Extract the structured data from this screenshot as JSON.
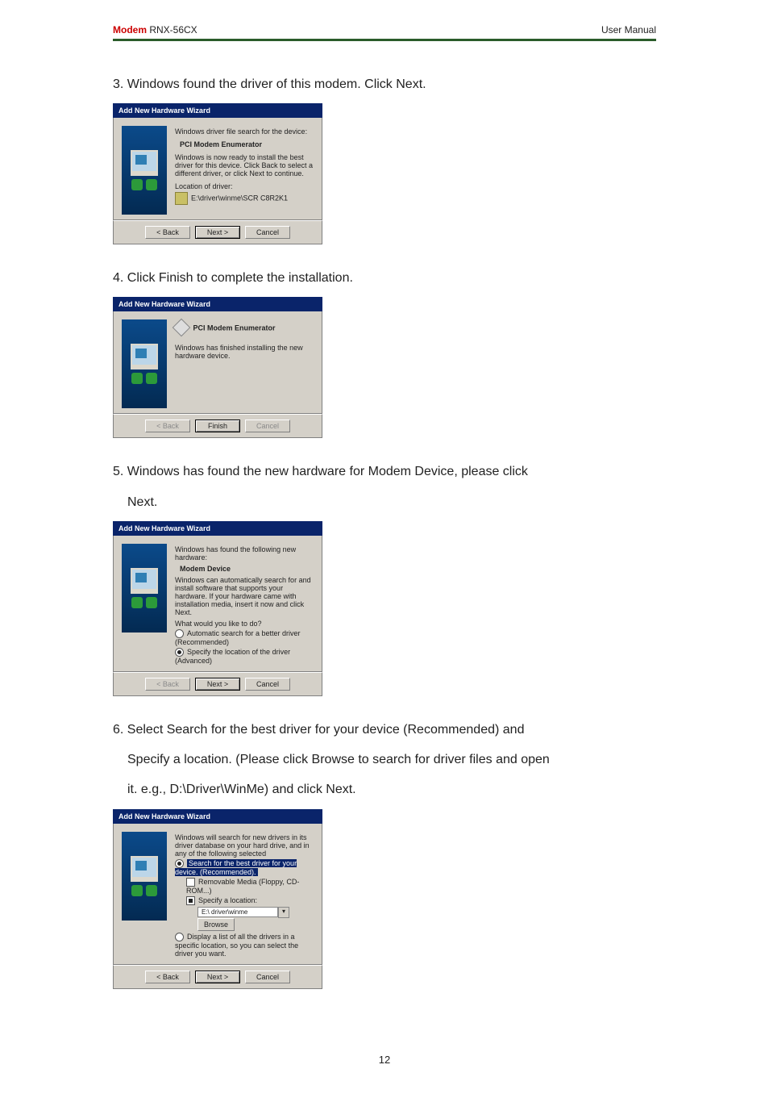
{
  "header": {
    "brand": "Modem",
    "model": " RNX-56CX",
    "right": "User  Manual"
  },
  "page_number": "12",
  "steps": {
    "s3": "3.    Windows found the driver of this modem. Click Next.",
    "s4": "4.    Click Finish to complete the installation.",
    "s5": "5.    Windows has found the new hardware for Modem Device, please click",
    "s5b": "Next.",
    "s6": "6.    Select Search for the best driver for your device (Recommended) and",
    "s6b": "Specify a location. (Please click Browse to search for driver files and open",
    "s6c": "it. e.g., D:\\Driver\\WinMe) and click Next."
  },
  "wiz": {
    "title": "Add New Hardware Wizard",
    "back": "< Back",
    "next": "Next >",
    "finish": "Finish",
    "cancel": "Cancel",
    "browse": "Browse"
  },
  "shot3": {
    "l1": "Windows driver file search for the device:",
    "l2": "PCI Modem Enumerator",
    "l3": "Windows is now ready to install the best driver for this device. Click Back to select a different driver, or click Next to continue.",
    "l4": "Location of driver:",
    "l5": "E:\\driver\\winme\\SCR C8R2K1"
  },
  "shot4": {
    "l1": "PCI Modem Enumerator",
    "l2": "Windows has finished installing the new hardware device."
  },
  "shot5": {
    "l1": "Windows has found the following new hardware:",
    "l2": "Modem Device",
    "l3": "Windows can automatically search for and install software that supports your hardware. If your hardware came with installation media, insert it now and click Next.",
    "l4": "What would you like to do?",
    "r1": "Automatic search for a better driver (Recommended)",
    "r2": "Specify the location of the driver (Advanced)"
  },
  "shot6": {
    "l1": "Windows will search for new drivers in its driver database on your hard drive, and in any of the following selected",
    "r1": "Search for the best driver for your device. (Recommended).",
    "c1": "Removable Media (Floppy, CD-ROM...)",
    "c2": "Specify a location:",
    "path": "E:\\ driver\\winme",
    "r2": "Display a list of all the drivers in a specific location, so you can select the driver you want."
  }
}
